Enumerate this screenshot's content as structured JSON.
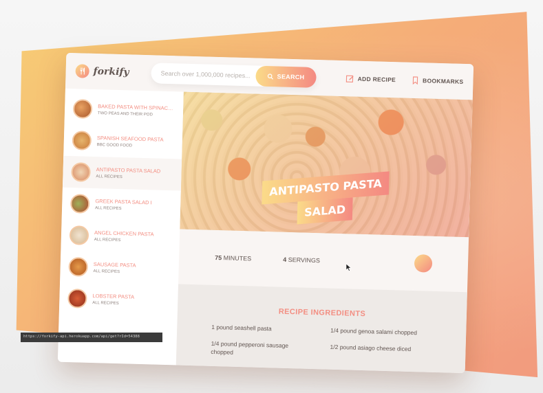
{
  "app": {
    "logo_text": "forkify"
  },
  "search": {
    "placeholder": "Search over 1,000,000 recipes...",
    "button_label": "SEARCH"
  },
  "nav": {
    "add_recipe": "ADD RECIPE",
    "bookmarks": "BOOKMARKS"
  },
  "results": [
    {
      "name": "BAKED PASTA WITH SPINACH AN...",
      "publisher": "TWO PEAS AND THEIR POD",
      "active": false
    },
    {
      "name": "SPANISH SEAFOOD PASTA",
      "publisher": "BBC GOOD FOOD",
      "active": false
    },
    {
      "name": "ANTIPASTO PASTA SALAD",
      "publisher": "ALL RECIPES",
      "active": true
    },
    {
      "name": "GREEK PASTA SALAD I",
      "publisher": "ALL RECIPES",
      "active": false
    },
    {
      "name": "ANGEL CHICKEN PASTA",
      "publisher": "ALL RECIPES",
      "active": false
    },
    {
      "name": "SAUSAGE PASTA",
      "publisher": "ALL RECIPES",
      "active": false
    },
    {
      "name": "LOBSTER PASTA",
      "publisher": "ALL RECIPES",
      "active": false
    }
  ],
  "recipe": {
    "title_line1": "ANTIPASTO PASTA",
    "title_line2": "SALAD",
    "minutes_value": "75",
    "minutes_label": "MINUTES",
    "servings_value": "4",
    "servings_label": "SERVINGS",
    "ingredients_heading": "RECIPE INGREDIENTS",
    "ingredients": [
      "1 pound seashell pasta",
      "1/4 pound genoa salami chopped",
      "1/4 pound pepperoni sausage chopped",
      "1/2 pound asiago cheese diced"
    ]
  },
  "statusbar": {
    "text": "https://forkify-api.herokuapp.com/api/get?rId=54388"
  },
  "colors": {
    "accent_start": "#fbdb89",
    "accent_end": "#f48982",
    "result_name": "#f38e82"
  }
}
